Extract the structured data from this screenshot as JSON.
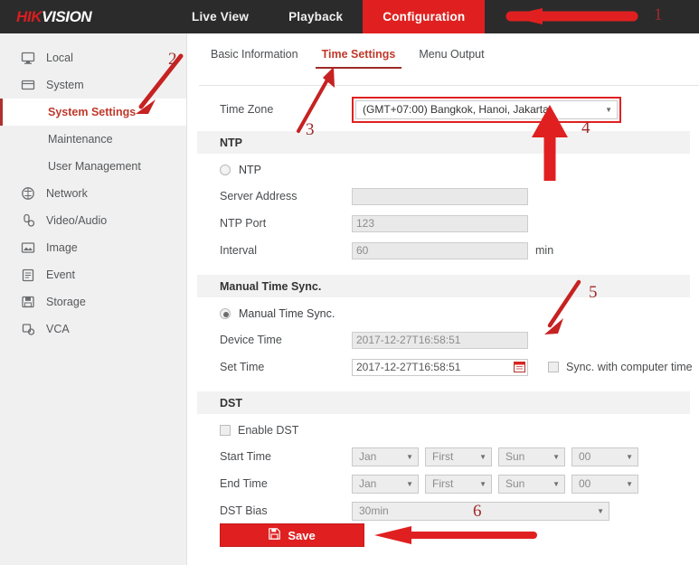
{
  "header": {
    "logo_hik": "HIK",
    "logo_vision": "VISION",
    "nav": [
      {
        "label": "Live View",
        "active": false
      },
      {
        "label": "Playback",
        "active": false
      },
      {
        "label": "Configuration",
        "active": true
      }
    ],
    "active_color": "#e02020"
  },
  "sidebar": {
    "items": [
      {
        "label": "Local",
        "icon": "monitor-icon",
        "type": "top"
      },
      {
        "label": "System",
        "icon": "system-icon",
        "type": "top"
      },
      {
        "label": "System Settings",
        "icon": "",
        "type": "sub",
        "active": true
      },
      {
        "label": "Maintenance",
        "icon": "",
        "type": "sub",
        "active": false
      },
      {
        "label": "User Management",
        "icon": "",
        "type": "sub",
        "active": false
      },
      {
        "label": "Network",
        "icon": "network-icon",
        "type": "top"
      },
      {
        "label": "Video/Audio",
        "icon": "video-audio-icon",
        "type": "top"
      },
      {
        "label": "Image",
        "icon": "image-icon",
        "type": "top"
      },
      {
        "label": "Event",
        "icon": "event-icon",
        "type": "top"
      },
      {
        "label": "Storage",
        "icon": "storage-icon",
        "type": "top"
      },
      {
        "label": "VCA",
        "icon": "vca-icon",
        "type": "top"
      }
    ]
  },
  "tabs": [
    {
      "label": "Basic Information",
      "active": false
    },
    {
      "label": "Time Settings",
      "active": true
    },
    {
      "label": "Menu Output",
      "active": false
    }
  ],
  "form": {
    "timezone": {
      "label": "Time Zone",
      "value": "(GMT+07:00) Bangkok, Hanoi, Jakarta",
      "highlight_color": "#e02020"
    },
    "ntp": {
      "section_title": "NTP",
      "radio_label": "NTP",
      "radio_selected": false,
      "server_address": {
        "label": "Server Address",
        "value": ""
      },
      "ntp_port": {
        "label": "NTP Port",
        "value": "123"
      },
      "interval": {
        "label": "Interval",
        "value": "60",
        "unit": "min"
      }
    },
    "manual": {
      "section_title": "Manual Time Sync.",
      "radio_label": "Manual Time Sync.",
      "radio_selected": true,
      "device_time": {
        "label": "Device Time",
        "value": "2017-12-27T16:58:51"
      },
      "set_time": {
        "label": "Set Time",
        "value": "2017-12-27T16:58:51"
      },
      "sync_checkbox": {
        "label": "Sync. with computer time",
        "checked": false
      }
    },
    "dst": {
      "section_title": "DST",
      "enable_label": "Enable DST",
      "enabled": false,
      "start_time": {
        "label": "Start Time",
        "month": "Jan",
        "week": "First",
        "day": "Sun",
        "hour": "00"
      },
      "end_time": {
        "label": "End Time",
        "month": "Jan",
        "week": "First",
        "day": "Sun",
        "hour": "00"
      },
      "bias": {
        "label": "DST Bias",
        "value": "30min"
      }
    }
  },
  "save_button": {
    "label": "Save",
    "icon": "save-icon"
  },
  "annotations": [
    {
      "number": "1"
    },
    {
      "number": "2"
    },
    {
      "number": "3"
    },
    {
      "number": "4"
    },
    {
      "number": "5"
    },
    {
      "number": "6"
    }
  ]
}
